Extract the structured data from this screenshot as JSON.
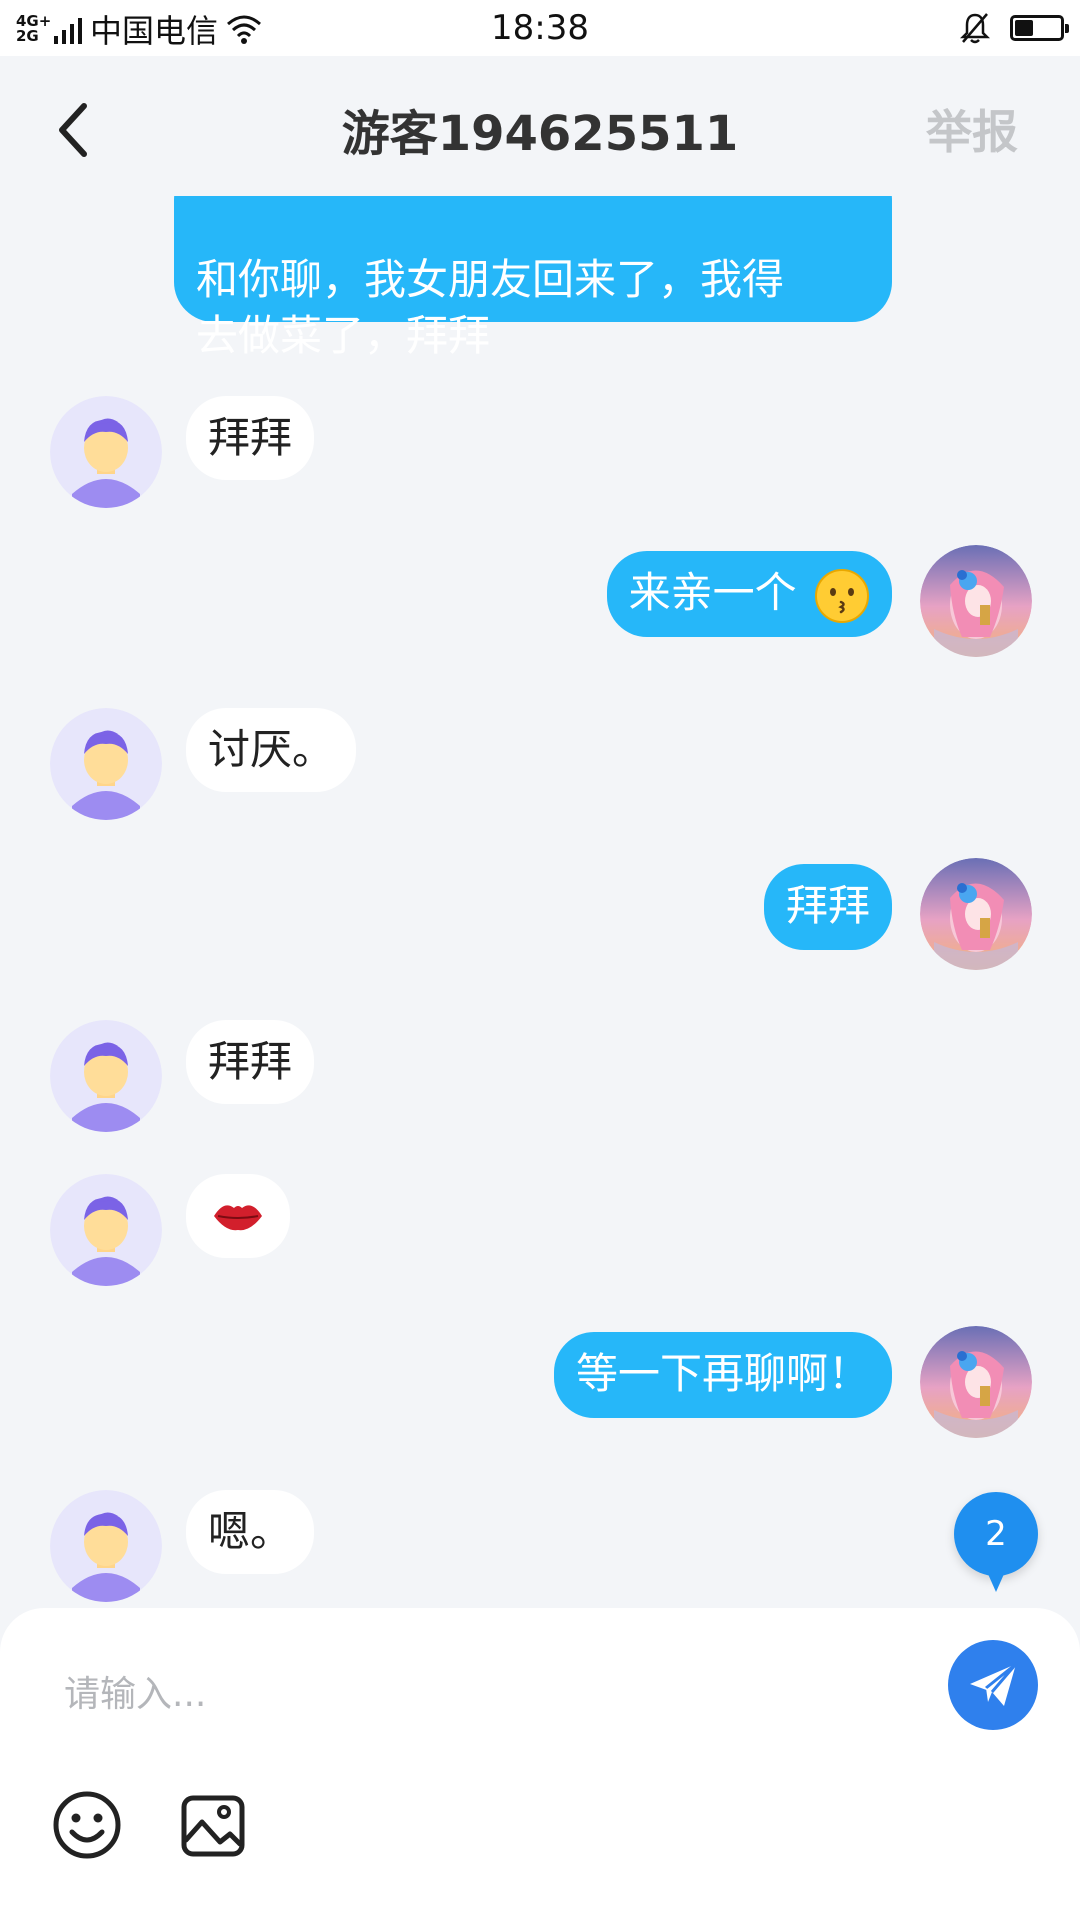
{
  "status_bar": {
    "network": "4G+\n2G",
    "carrier": "中国电信",
    "time": "18:38",
    "battery_level": 0.4
  },
  "header": {
    "title": "游客194625511",
    "report_label": "举报"
  },
  "messages": [
    {
      "side": "out",
      "text": "和你聊，我女朋友回来了，我得\n去做菜了，拜拜"
    },
    {
      "side": "in",
      "text": "拜拜"
    },
    {
      "side": "out",
      "text": "来亲一个",
      "emoji": "kissing-face-emoji"
    },
    {
      "side": "in",
      "text": "讨厌。"
    },
    {
      "side": "out",
      "text": "拜拜"
    },
    {
      "side": "in",
      "text": "拜拜"
    },
    {
      "side": "in",
      "text": "",
      "emoji": "lips-kiss-emoji"
    },
    {
      "side": "out",
      "text": "等一下再聊啊！"
    },
    {
      "side": "in",
      "text": "嗯。"
    }
  ],
  "unread_count": "2",
  "composer": {
    "placeholder": "请输入...",
    "send_icon": "send-icon",
    "tools": [
      "emoji-icon",
      "image-icon"
    ]
  },
  "colors": {
    "outgoing_bubble": "#26b7f9",
    "incoming_bubble": "#ffffff",
    "send_button": "#2f80ed",
    "background": "#f3f5f8"
  }
}
